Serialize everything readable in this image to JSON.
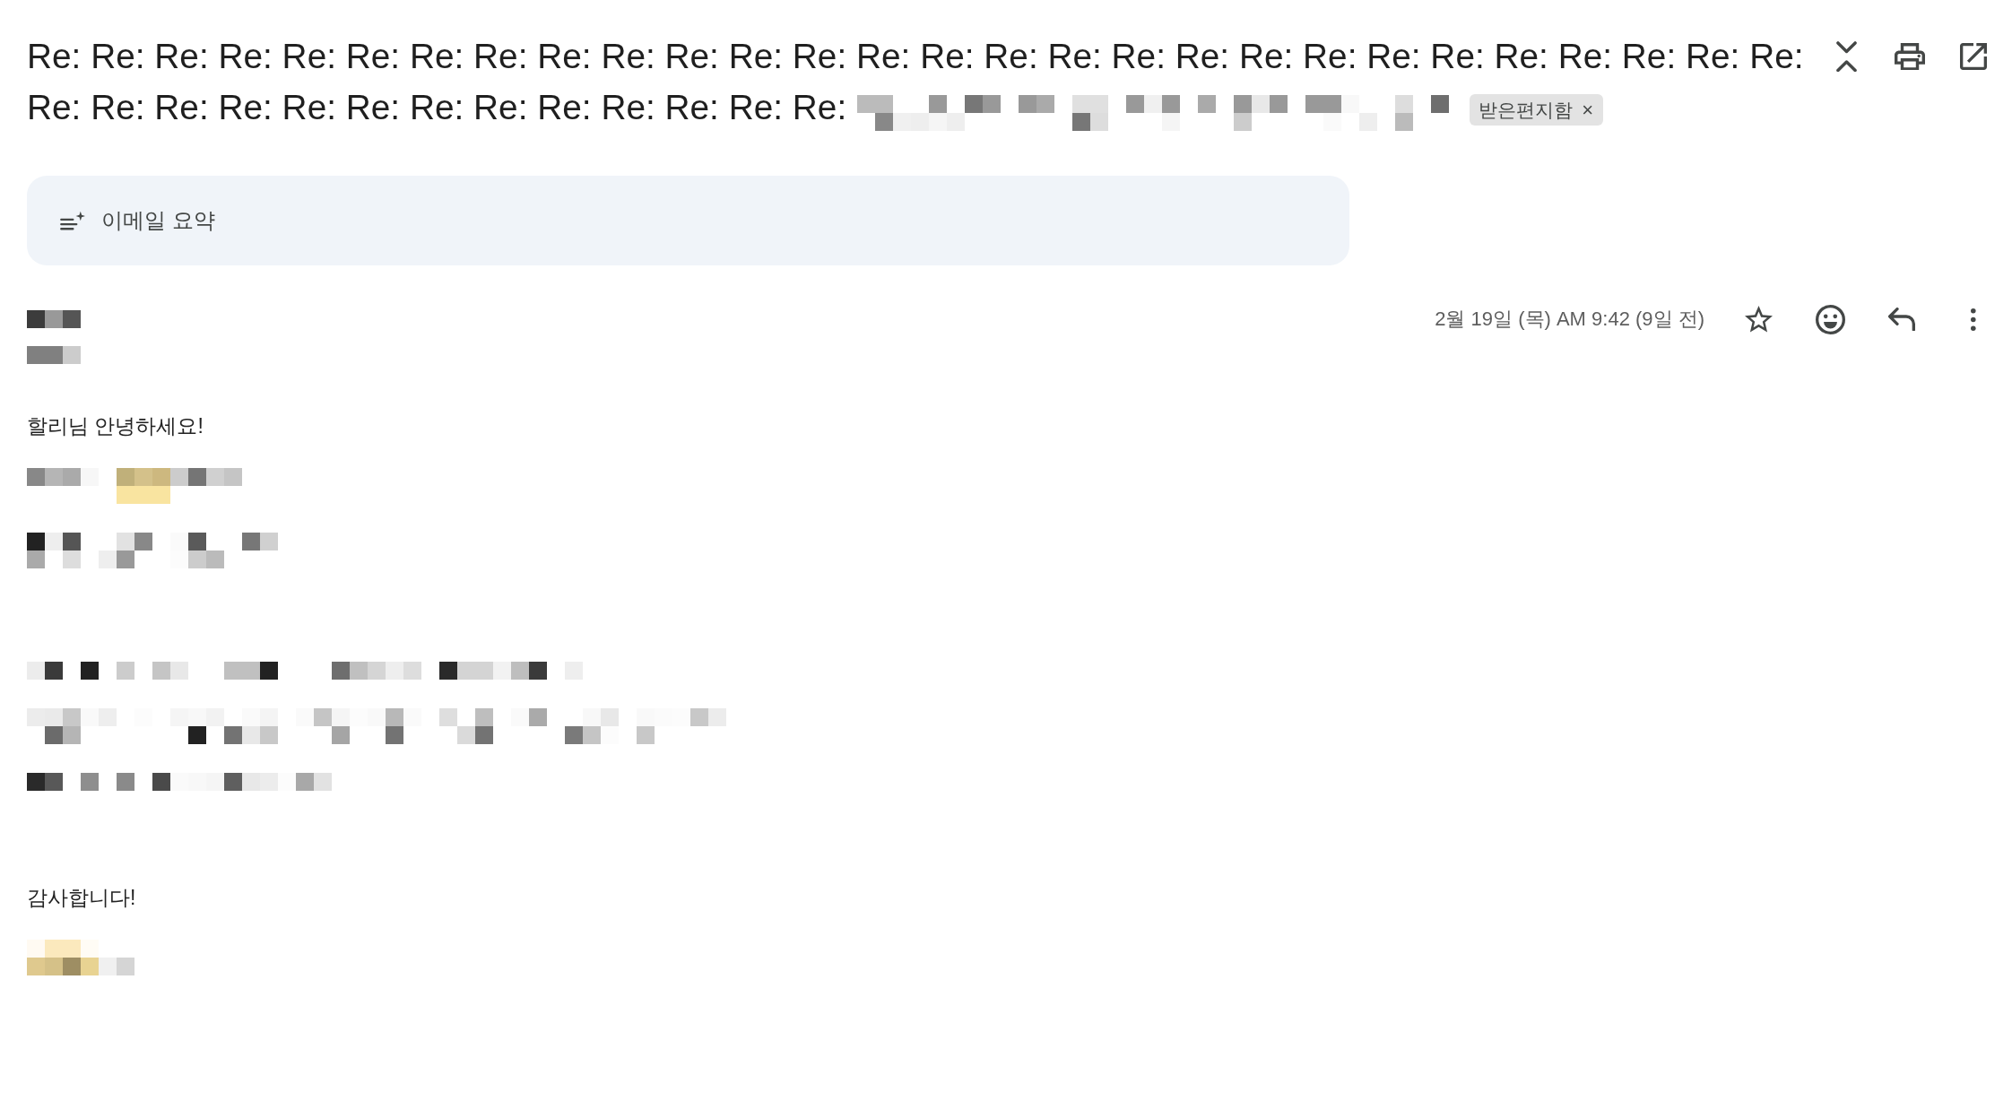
{
  "subject": {
    "text": "Re: Re: Re: Re: Re: Re: Re: Re: Re: Re: Re: Re: Re: Re: Re: Re: Re: Re: Re: Re: Re: Re: Re: Re: Re: Re: Re: Re: Re: Re: Re: Re: Re: Re: Re: Re: Re: Re: Re: Re: Re:",
    "redacted": true,
    "label": {
      "text": "받은편지함",
      "remove": "×"
    }
  },
  "summary": {
    "label": "이메일 요약"
  },
  "message": {
    "sender_redacted": true,
    "address_redacted": true,
    "date": "2월 19일 (목) AM 9:42 (9일 전)",
    "starred": false,
    "body": [
      {
        "lines": [
          {
            "kind": "text",
            "text": "할리님 안녕하세요!"
          },
          {
            "kind": "redacted"
          },
          {
            "kind": "redacted"
          }
        ]
      },
      {
        "lines": [
          {
            "kind": "redacted"
          },
          {
            "kind": "redacted"
          },
          {
            "kind": "redacted"
          }
        ]
      },
      {
        "lines": [
          {
            "kind": "text",
            "text": "감사합니다!"
          },
          {
            "kind": "redacted"
          }
        ]
      }
    ]
  }
}
